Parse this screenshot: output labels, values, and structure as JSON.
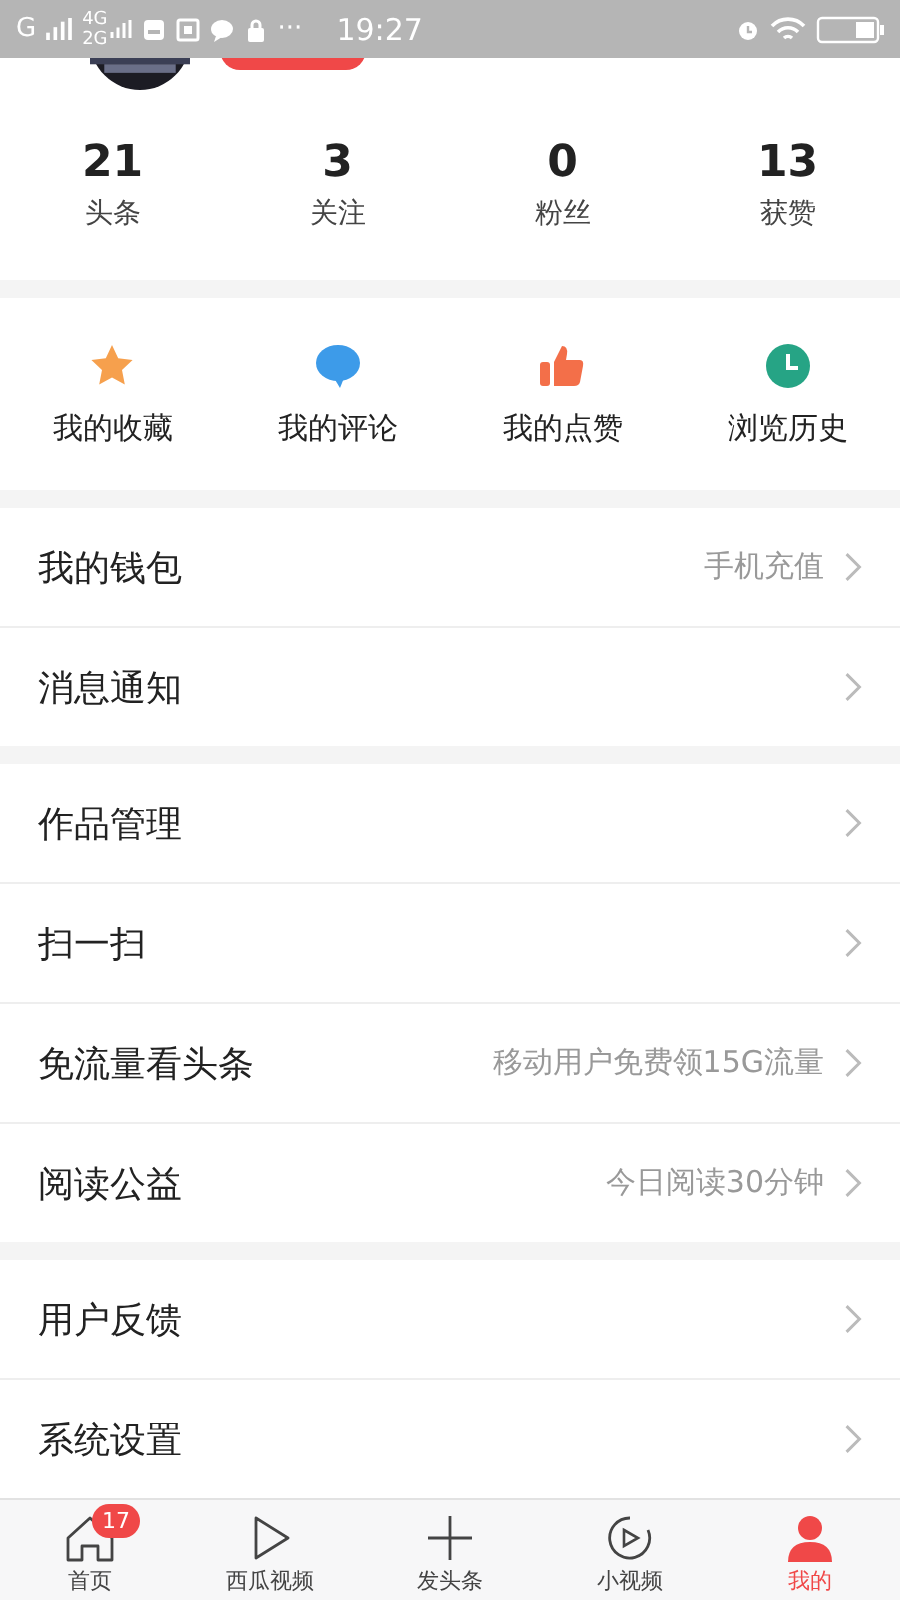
{
  "status_bar": {
    "network": "G",
    "network_top": "4G",
    "network_bottom": "2G",
    "more": "···",
    "time": "19:27"
  },
  "stats": [
    {
      "value": "21",
      "label": "头条"
    },
    {
      "value": "3",
      "label": "关注"
    },
    {
      "value": "0",
      "label": "粉丝"
    },
    {
      "value": "13",
      "label": "获赞"
    }
  ],
  "shortcuts": [
    {
      "kind": "star",
      "label": "我的收藏",
      "color": "#f6a04d"
    },
    {
      "kind": "comment",
      "label": "我的评论",
      "color": "#3d9be9"
    },
    {
      "kind": "like",
      "label": "我的点赞",
      "color": "#f36f49"
    },
    {
      "kind": "history",
      "label": "浏览历史",
      "color": "#26a485"
    }
  ],
  "menu_groups": [
    [
      {
        "label": "我的钱包",
        "value": "手机充值"
      },
      {
        "label": "消息通知"
      }
    ],
    [
      {
        "label": "作品管理"
      },
      {
        "label": "扫一扫"
      },
      {
        "label": "免流量看头条",
        "value": "移动用户免费领15G流量"
      },
      {
        "label": "阅读公益",
        "value": "今日阅读30分钟"
      }
    ],
    [
      {
        "label": "用户反馈"
      },
      {
        "label": "系统设置"
      }
    ]
  ],
  "tab_bar": [
    {
      "kind": "home",
      "label": "首页",
      "badge": "17",
      "selected": false
    },
    {
      "kind": "play",
      "label": "西瓜视频",
      "selected": false
    },
    {
      "kind": "plus",
      "label": "发头条",
      "selected": false
    },
    {
      "kind": "video",
      "label": "小视频",
      "selected": false
    },
    {
      "kind": "user",
      "label": "我的",
      "selected": true
    }
  ]
}
